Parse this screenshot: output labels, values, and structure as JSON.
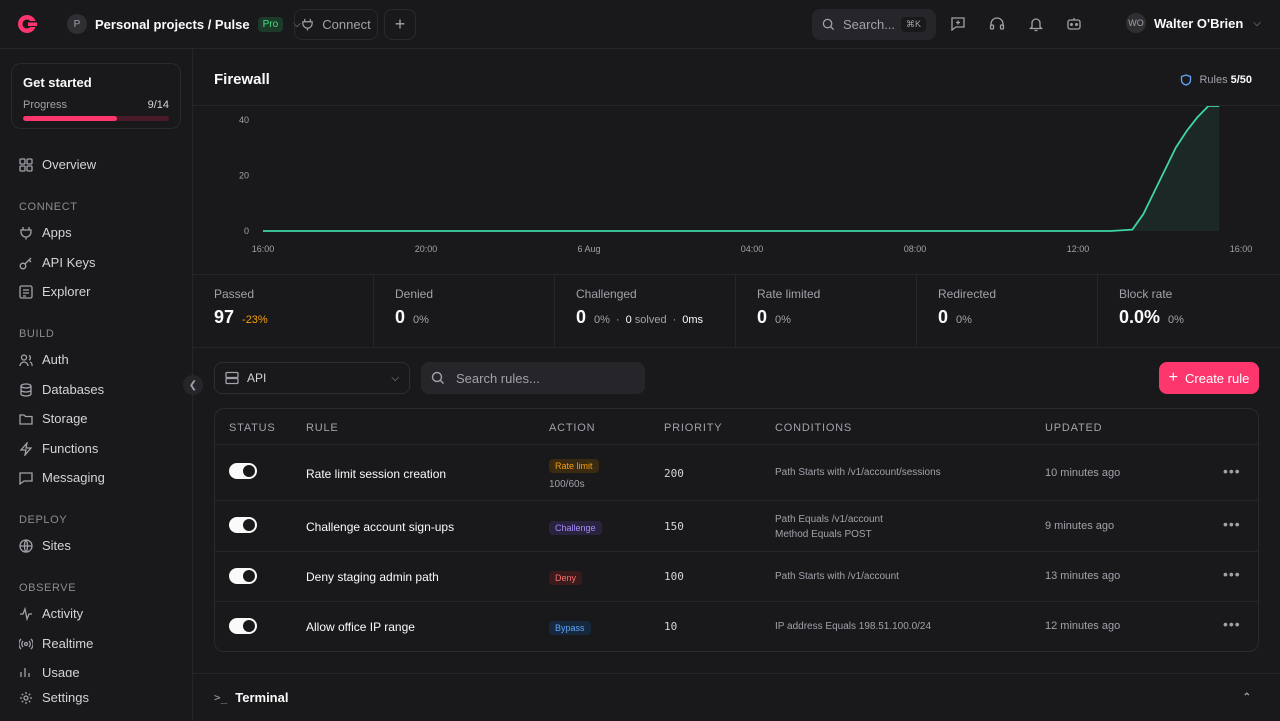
{
  "topbar": {
    "project_avatar": "P",
    "project_name": "Personal projects / Pulse",
    "plan_badge": "Pro",
    "connect_label": "Connect",
    "search_label": "Search...",
    "search_shortcut": "⌘K",
    "user_initials": "WO",
    "user_name": "Walter O'Brien"
  },
  "sidebar": {
    "get_started": {
      "title": "Get started",
      "progress_label": "Progress",
      "progress_text": "9/14",
      "progress_fraction": 0.643
    },
    "overview": "Overview",
    "sections": {
      "connect": "CONNECT",
      "build": "BUILD",
      "deploy": "DEPLOY",
      "observe": "OBSERVE"
    },
    "connect_items": [
      "Apps",
      "API Keys",
      "Explorer"
    ],
    "build_items": [
      "Auth",
      "Databases",
      "Storage",
      "Functions",
      "Messaging"
    ],
    "deploy_items": [
      "Sites"
    ],
    "observe_items": [
      "Activity",
      "Realtime",
      "Usage"
    ],
    "settings": "Settings"
  },
  "header": {
    "title": "Firewall",
    "rules_label": "Rules",
    "rules_count": "5/50"
  },
  "chart_data": {
    "type": "area",
    "x": [
      "16:00",
      "20:00",
      "6 Aug",
      "04:00",
      "08:00",
      "12:00",
      "16:00"
    ],
    "y_ticks": [
      0,
      20,
      40
    ],
    "ylim": [
      0,
      45
    ],
    "series": [
      {
        "points": [
          [
            0,
            0
          ],
          [
            10,
            0
          ],
          [
            20,
            0
          ],
          [
            30,
            0
          ],
          [
            40,
            0
          ],
          [
            50,
            0
          ],
          [
            60,
            0
          ],
          [
            65,
            0
          ],
          [
            70,
            0
          ],
          [
            75,
            0
          ],
          [
            78,
            0
          ],
          [
            80,
            0.5
          ],
          [
            81,
            6
          ],
          [
            82,
            14
          ],
          [
            83,
            22
          ],
          [
            84,
            30
          ],
          [
            85,
            36
          ],
          [
            86,
            41
          ],
          [
            87,
            45
          ],
          [
            88,
            45
          ]
        ]
      }
    ],
    "color": "#3ed6a5"
  },
  "stats": [
    {
      "label": "Passed",
      "value": "97",
      "pct": "-23%"
    },
    {
      "label": "Denied",
      "value": "0",
      "pct": "0%"
    },
    {
      "label": "Challenged",
      "value": "0",
      "pct": "0%",
      "solved_value": "0",
      "solved_label": "solved",
      "time": "0ms"
    },
    {
      "label": "Rate limited",
      "value": "0",
      "pct": "0%"
    },
    {
      "label": "Redirected",
      "value": "0",
      "pct": "0%"
    },
    {
      "label": "Block rate",
      "value": "0.0%",
      "pct": "0%"
    }
  ],
  "toolbar": {
    "filter_value": "API",
    "search_placeholder": "Search rules...",
    "create_label": "Create rule"
  },
  "table": {
    "columns": [
      "STATUS",
      "RULE",
      "ACTION",
      "PRIORITY",
      "CONDITIONS",
      "UPDATED"
    ],
    "rows": [
      {
        "rule": "Rate limit session creation",
        "action": "Rate limit",
        "action_sub": "100/60s",
        "priority": "200",
        "conditions": [
          "Path Starts with /v1/account/sessions"
        ],
        "updated": "10 minutes ago"
      },
      {
        "rule": "Challenge account sign-ups",
        "action": "Challenge",
        "action_sub": "",
        "priority": "150",
        "conditions": [
          "Path Equals /v1/account",
          "Method Equals POST"
        ],
        "updated": "9 minutes ago"
      },
      {
        "rule": "Deny staging admin path",
        "action": "Deny",
        "action_sub": "",
        "priority": "100",
        "conditions": [
          "Path Starts with /v1/account"
        ],
        "updated": "13 minutes ago"
      },
      {
        "rule": "Allow office IP range",
        "action": "Bypass",
        "action_sub": "",
        "priority": "10",
        "conditions": [
          "IP address Equals 198.51.100.0/24"
        ],
        "updated": "12 minutes ago"
      }
    ]
  },
  "terminal": {
    "label": "Terminal"
  }
}
